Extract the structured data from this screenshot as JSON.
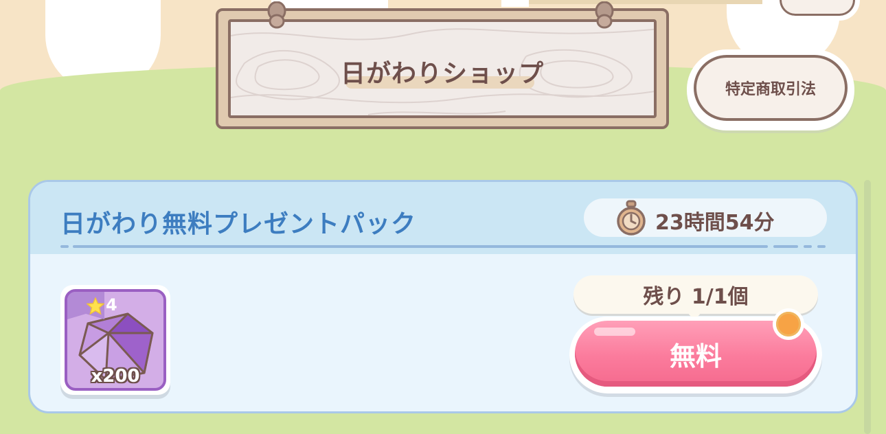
{
  "header": {
    "shop_title": "日がわりショップ",
    "legal_button_label": "特定商取引法"
  },
  "pack": {
    "title": "日がわり無料プレゼントパック",
    "timer_text": "23時間54分",
    "item": {
      "rarity": "4",
      "quantity": "x200",
      "icon": "purple-gem-icon"
    },
    "remaining_text": "残り 1/1個",
    "buy_button_label": "無料"
  },
  "colors": {
    "background_green": "#d3e6a2",
    "awning_beige": "#f7e4c6",
    "sign_text": "#6e4f4b",
    "card_title_blue": "#3d7dc0",
    "card_header": "#cbe6f4",
    "free_button_pink": "#fb7b9c",
    "notification_orange": "#f7a345"
  }
}
